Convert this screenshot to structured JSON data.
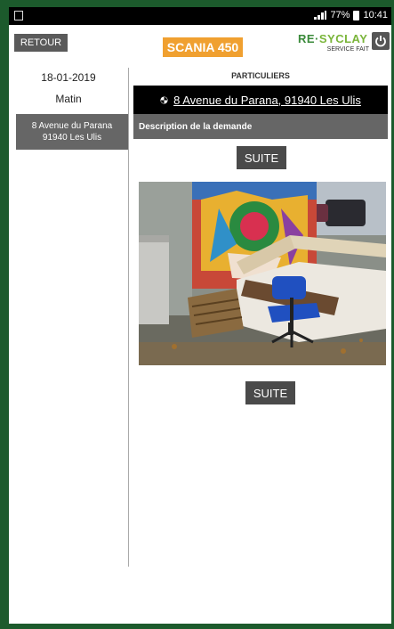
{
  "status_bar": {
    "battery": "77%",
    "time": "10:41"
  },
  "header": {
    "back_label": "RETOUR",
    "vehicle_label": "SCANIA 450",
    "logo": {
      "part1": "RE·",
      "part2": "SYCLAY",
      "tagline": "SERVICE FAIT"
    }
  },
  "sidebar": {
    "date": "18-01-2019",
    "period": "Matin",
    "address_line1": "8 Avenue du Parana",
    "address_line2": "91940 Les Ulis"
  },
  "main": {
    "category": "PARTICULIERS",
    "address": "8 Avenue du Parana, 91940 Les Ulis",
    "description_label": "Description de la demande",
    "suite_label_top": "SUITE",
    "suite_label_bottom": "SUITE"
  },
  "colors": {
    "accent_orange": "#f0a030",
    "frame_green": "#1c5a2c",
    "logo_green": "#3a8a3a"
  }
}
